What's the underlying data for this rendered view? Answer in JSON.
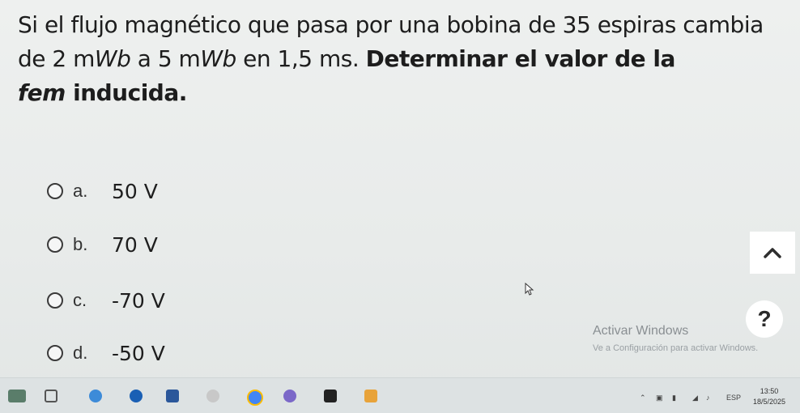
{
  "question": {
    "part1": "Si el flujo magnético que pasa por una bobina de 35 espiras cambia de 2 m",
    "unit1": "Wb",
    "part2": " a 5 m",
    "unit2": "Wb",
    "part3": " en 1,5 ms. ",
    "bold_part": "Determinar el valor de la ",
    "fem": "fem",
    "bold_end": " inducida."
  },
  "options": [
    {
      "letter": "a.",
      "value": "50 V"
    },
    {
      "letter": "b.",
      "value": "70 V"
    },
    {
      "letter": "c.",
      "value": "-70 V"
    },
    {
      "letter": "d.",
      "value": "-50 V"
    }
  ],
  "controls": {
    "scroll_up_glyph": "^",
    "help_glyph": "?"
  },
  "watermark": {
    "title": "Activar Windows",
    "subtitle": "Ve a Configuración para activar Windows."
  },
  "taskbar": {
    "language": "ESP",
    "time": "13:50",
    "date": "18/5/2025"
  },
  "colors": {
    "background": "#e9eceb",
    "taskbar": "#dde2e3",
    "text": "#1d1d1d"
  }
}
